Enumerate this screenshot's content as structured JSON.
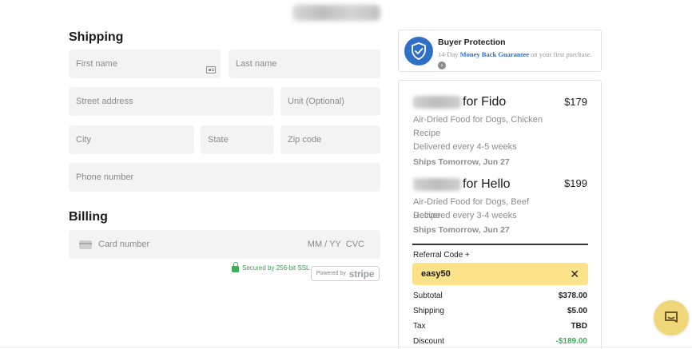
{
  "shipping": {
    "title": "Shipping",
    "first_name_placeholder": "First name",
    "last_name_placeholder": "Last name",
    "street_placeholder": "Street address",
    "unit_placeholder": "Unit (Optional)",
    "city_placeholder": "City",
    "state_placeholder": "State",
    "zip_placeholder": "Zip code",
    "phone_placeholder": "Phone number"
  },
  "billing": {
    "title": "Billing",
    "card_placeholder": "Card number",
    "expiry_placeholder": "MM / YY",
    "cvc_placeholder": "CVC",
    "ssl_text": "Secured by 256-bit SSL",
    "powered_by": "Powered by",
    "stripe": "stripe"
  },
  "protection": {
    "title": "Buyer Protection",
    "text_before": "14-Day",
    "guarantee": "Money Back Guarantee",
    "text_after": "on your first purchase."
  },
  "order": {
    "items": [
      {
        "name": "for Fido",
        "price": "$179",
        "description": "Air-Dried Food for Dogs, Chicken Recipe",
        "frequency": "Delivered every 4-5 weeks",
        "ships": "Ships Tomorrow, Jun 27"
      },
      {
        "name": "for Hello",
        "price": "$199",
        "description": "Air-Dried Food for Dogs, Beef Recipe",
        "frequency": "Delivered every 3-4 weeks",
        "ships": "Ships Tomorrow, Jun 27"
      }
    ],
    "referral_label": "Referral Code +",
    "referral_code": "easy50",
    "remove_glyph": "✕",
    "totals": [
      {
        "label": "Subtotal",
        "value": "$378.00"
      },
      {
        "label": "Shipping",
        "value": "$5.00"
      },
      {
        "label": "Tax",
        "value": "TBD"
      },
      {
        "label": "Discount",
        "value": "-$189.00"
      }
    ]
  },
  "colors": {
    "accent_blue": "#2f6fc5",
    "referral_yellow": "#fce38a",
    "secure_green": "#3fae5a",
    "chat_yellow": "#f0d77a"
  },
  "icons": {
    "shield": "shield-check-icon",
    "chat": "chat-icon",
    "lock": "lock-icon",
    "card": "credit-card-icon",
    "contact": "contact-card-icon",
    "arrow": "arrow-right-icon",
    "close": "close-icon"
  }
}
